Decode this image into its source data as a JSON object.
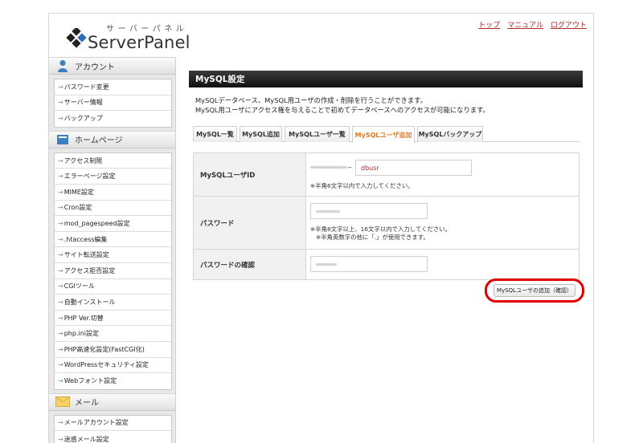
{
  "header": {
    "logo_kana": "サーバーパネル",
    "logo_text": "ServerPanel",
    "links": [
      "トップ",
      "マニュアル",
      "ログアウト"
    ]
  },
  "sidebar": {
    "sections": [
      {
        "title": "アカウント",
        "icon": "user-icon",
        "items": [
          "パスワード変更",
          "サーバー情報",
          "バックアップ"
        ]
      },
      {
        "title": "ホームページ",
        "icon": "homepage-icon",
        "items": [
          "アクセス制限",
          "エラーページ設定",
          "MIME設定",
          "Cron設定",
          "mod_pagespeed設定",
          ".htaccess編集",
          "サイト転送設定",
          "アクセス拒否設定",
          "CGIツール",
          "自動インストール",
          "PHP Ver.切替",
          "php.ini設定",
          "PHP高速化設定(FastCGI化)",
          "WordPressセキュリティ設定",
          "Webフォント設定"
        ]
      },
      {
        "title": "メール",
        "icon": "mail-icon",
        "items": [
          "メールアカウント設定",
          "迷惑メール設定"
        ]
      }
    ]
  },
  "main": {
    "title": "MySQL設定",
    "intro_line1": "MySQLデータベース、MySQL用ユーザの作成・削除を行うことができます。",
    "intro_line2": "MySQL用ユーザにアクセス権を与えることで初めてデータベースへのアクセスが可能になります。",
    "tabs": [
      "MySQL一覧",
      "MySQL追加",
      "MySQLユーザ一覧",
      "MySQLユーザ追加",
      "MySQLバックアップ"
    ],
    "active_tab": "MySQLユーザ追加",
    "form": {
      "user_label": "MySQLユーザID",
      "user_prefix_sep": "_",
      "user_value": "dbusr",
      "user_note": "※半角6文字以内で入力してください。",
      "password_label": "パスワード",
      "password_note1": "※半角8文字以上、16文字以内で入力してください。",
      "password_note2": "※半角英数字の他に「.」が使用できます。",
      "confirm_label": "パスワードの確認"
    },
    "submit_label": "MySQLユーザの追加（確認）"
  },
  "colors": {
    "accent_orange": "#e07a1b",
    "link_red": "#b02a2a",
    "highlight_red": "#e00000"
  }
}
